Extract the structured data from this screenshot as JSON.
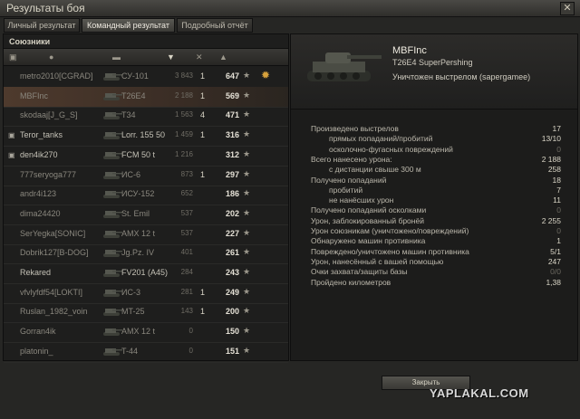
{
  "window": {
    "title": "Результаты боя",
    "close_label": "✕"
  },
  "tabs": [
    {
      "label": "Личный результат",
      "active": false
    },
    {
      "label": "Командный результат",
      "active": true
    },
    {
      "label": "Подробный отчёт",
      "active": false
    }
  ],
  "allies": {
    "title": "Союзники",
    "rows": [
      {
        "name": "metro2010[CGRAD]",
        "vehicle": "СУ-101",
        "damage": "3 843",
        "kills": "1",
        "xp": "647",
        "medal": true,
        "dead": true,
        "highlight": false,
        "tag": ""
      },
      {
        "name": "MBFInc",
        "vehicle": "T26E4",
        "damage": "2 188",
        "kills": "1",
        "xp": "569",
        "medal": false,
        "dead": true,
        "highlight": true,
        "tag": ""
      },
      {
        "name": "skodaaj[J_G_S]",
        "vehicle": "T34",
        "damage": "1 563",
        "kills": "4",
        "xp": "471",
        "medal": false,
        "dead": true,
        "highlight": false,
        "tag": ""
      },
      {
        "name": "Teror_tanks",
        "vehicle": "Lorr. 155 50",
        "damage": "1 459",
        "kills": "1",
        "xp": "316",
        "medal": false,
        "dead": false,
        "highlight": false,
        "tag": "platoon"
      },
      {
        "name": "den4ik270",
        "vehicle": "FCM 50 t",
        "damage": "1 216",
        "kills": "",
        "xp": "312",
        "medal": false,
        "dead": false,
        "highlight": false,
        "tag": "platoon"
      },
      {
        "name": "777seryoga777",
        "vehicle": "ИС-6",
        "damage": "873",
        "kills": "1",
        "xp": "297",
        "medal": false,
        "dead": true,
        "highlight": false,
        "tag": ""
      },
      {
        "name": "andr4i123",
        "vehicle": "ИСУ-152",
        "damage": "652",
        "kills": "",
        "xp": "186",
        "medal": false,
        "dead": true,
        "highlight": false,
        "tag": ""
      },
      {
        "name": "dima24420",
        "vehicle": "St. Emil",
        "damage": "537",
        "kills": "",
        "xp": "202",
        "medal": false,
        "dead": true,
        "highlight": false,
        "tag": ""
      },
      {
        "name": "SerYegka[SONIC]",
        "vehicle": "AMX 12 t",
        "damage": "537",
        "kills": "",
        "xp": "227",
        "medal": false,
        "dead": true,
        "highlight": false,
        "tag": ""
      },
      {
        "name": "Dobrik127[B-DOG]",
        "vehicle": "Jg.Pz. IV",
        "damage": "401",
        "kills": "",
        "xp": "261",
        "medal": false,
        "dead": true,
        "highlight": false,
        "tag": ""
      },
      {
        "name": "Rekared",
        "vehicle": "FV201 (A45)",
        "damage": "284",
        "kills": "",
        "xp": "243",
        "medal": false,
        "dead": false,
        "highlight": false,
        "tag": ""
      },
      {
        "name": "vfvlyfdf54[LOKTI]",
        "vehicle": "ИС-3",
        "damage": "281",
        "kills": "1",
        "xp": "249",
        "medal": false,
        "dead": true,
        "highlight": false,
        "tag": ""
      },
      {
        "name": "Ruslan_1982_voin",
        "vehicle": "MT-25",
        "damage": "143",
        "kills": "1",
        "xp": "200",
        "medal": false,
        "dead": true,
        "highlight": false,
        "tag": ""
      },
      {
        "name": "Gorran4ik",
        "vehicle": "AMX 12 t",
        "damage": "0",
        "kills": "",
        "xp": "150",
        "medal": false,
        "dead": true,
        "highlight": false,
        "tag": ""
      },
      {
        "name": "platonin_",
        "vehicle": "T-44",
        "damage": "0",
        "kills": "",
        "xp": "151",
        "medal": false,
        "dead": true,
        "highlight": false,
        "tag": ""
      }
    ]
  },
  "detail": {
    "player": "MBFInc",
    "vehicle": "T26E4 SuperPershing",
    "status": "Уничтожен выстрелом (sapergamee)",
    "stats": [
      {
        "label": "Произведено выстрелов",
        "value": "17",
        "indent": 0
      },
      {
        "label": "прямых попаданий/пробитий",
        "value": "13/10",
        "indent": 1
      },
      {
        "label": "осколочно-фугасных повреждений",
        "value": "0",
        "indent": 1
      },
      {
        "label": "Всего нанесено урона:",
        "value": "2 188",
        "indent": 0
      },
      {
        "label": "с дистанции свыше 300 м",
        "value": "258",
        "indent": 1
      },
      {
        "label": "Получено попаданий",
        "value": "18",
        "indent": 0
      },
      {
        "label": "пробитий",
        "value": "7",
        "indent": 1
      },
      {
        "label": "не нанёсших урон",
        "value": "11",
        "indent": 1
      },
      {
        "label": "Получено попаданий осколками",
        "value": "0",
        "indent": 0
      },
      {
        "label": "Урон, заблокированный бронёй",
        "value": "2 255",
        "indent": 0
      },
      {
        "label": "Урон союзникам (уничтожено/повреждений)",
        "value": "0",
        "indent": 0
      },
      {
        "label": "Обнаружено машин противника",
        "value": "1",
        "indent": 0
      },
      {
        "label": "Повреждено/уничтожено машин противника",
        "value": "5/1",
        "indent": 0
      },
      {
        "label": "Урон, нанесённый с вашей помощью",
        "value": "247",
        "indent": 0
      },
      {
        "label": "Очки захвата/защиты базы",
        "value": "0/0",
        "indent": 0
      },
      {
        "label": "Пройдено километров",
        "value": "1,38",
        "indent": 0
      }
    ],
    "close_button": "Закрыть"
  },
  "watermark": "YAPLAKAL.COM"
}
